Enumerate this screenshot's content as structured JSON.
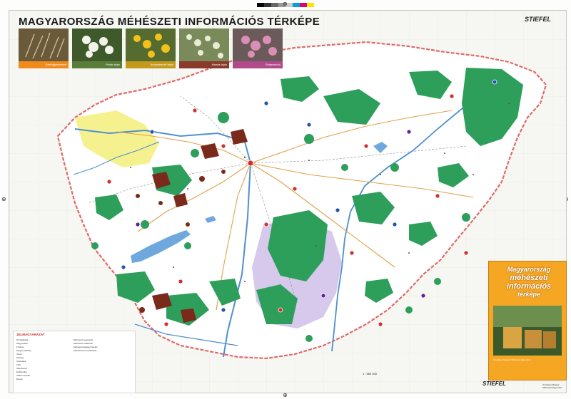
{
  "map": {
    "title": "MAGYARORSZÁG MÉHÉSZETI INFORMÁCIÓS TÉRKÉPE",
    "publisher": "STIEFEL",
    "scale_text": "1 : 560 000",
    "colors": {
      "forest": "#2e9e5b",
      "acacia_region": "#7a2a1a",
      "lavender_region": "#c8b7e6",
      "rapeseed_region": "#f2ec6a",
      "border": "#e06a6a",
      "water": "#6fa8dc",
      "roads": "#e2a14a",
      "background": "#f6f7f2"
    }
  },
  "photos": [
    {
      "caption": "Szelídgesztenye",
      "color": "#f08a1c",
      "icon": "chestnut-photo"
    },
    {
      "caption": "Fehér akác",
      "color": "#5a7d3a",
      "icon": "acacia-photo"
    },
    {
      "caption": "Aranyvessző fajok",
      "color": "#c39a1b",
      "icon": "goldenrod-photo"
    },
    {
      "caption": "Hársfa fajok",
      "color": "#8a3a2a",
      "icon": "linden-photo"
    },
    {
      "caption": "Selyemkóró",
      "color": "#b04a8a",
      "icon": "milkweed-photo"
    }
  ],
  "legend": {
    "title": "JELMAGYARÁZAT",
    "items": [
      "Országhatár",
      "Megyehatár",
      "Főváros",
      "Megyeszékhely",
      "Város",
      "Község",
      "Autópálya",
      "Főút",
      "Vasútvonal",
      "Erdőterület",
      "Akácos terület",
      "Repce",
      "Méhészeti egyesület",
      "Méhészeti szaküzlet",
      "Méhegészségügyi felelős",
      "Méhészeti bemutatóhely"
    ]
  },
  "cover": {
    "line1": "Magyarország",
    "line2": "méhészeti",
    "line3": "információs",
    "line4": "térképe",
    "note": "Országos Magyar Méhészeti Egyesület"
  },
  "footer_note": "Országos Magyar Méhészeti Egyesület"
}
